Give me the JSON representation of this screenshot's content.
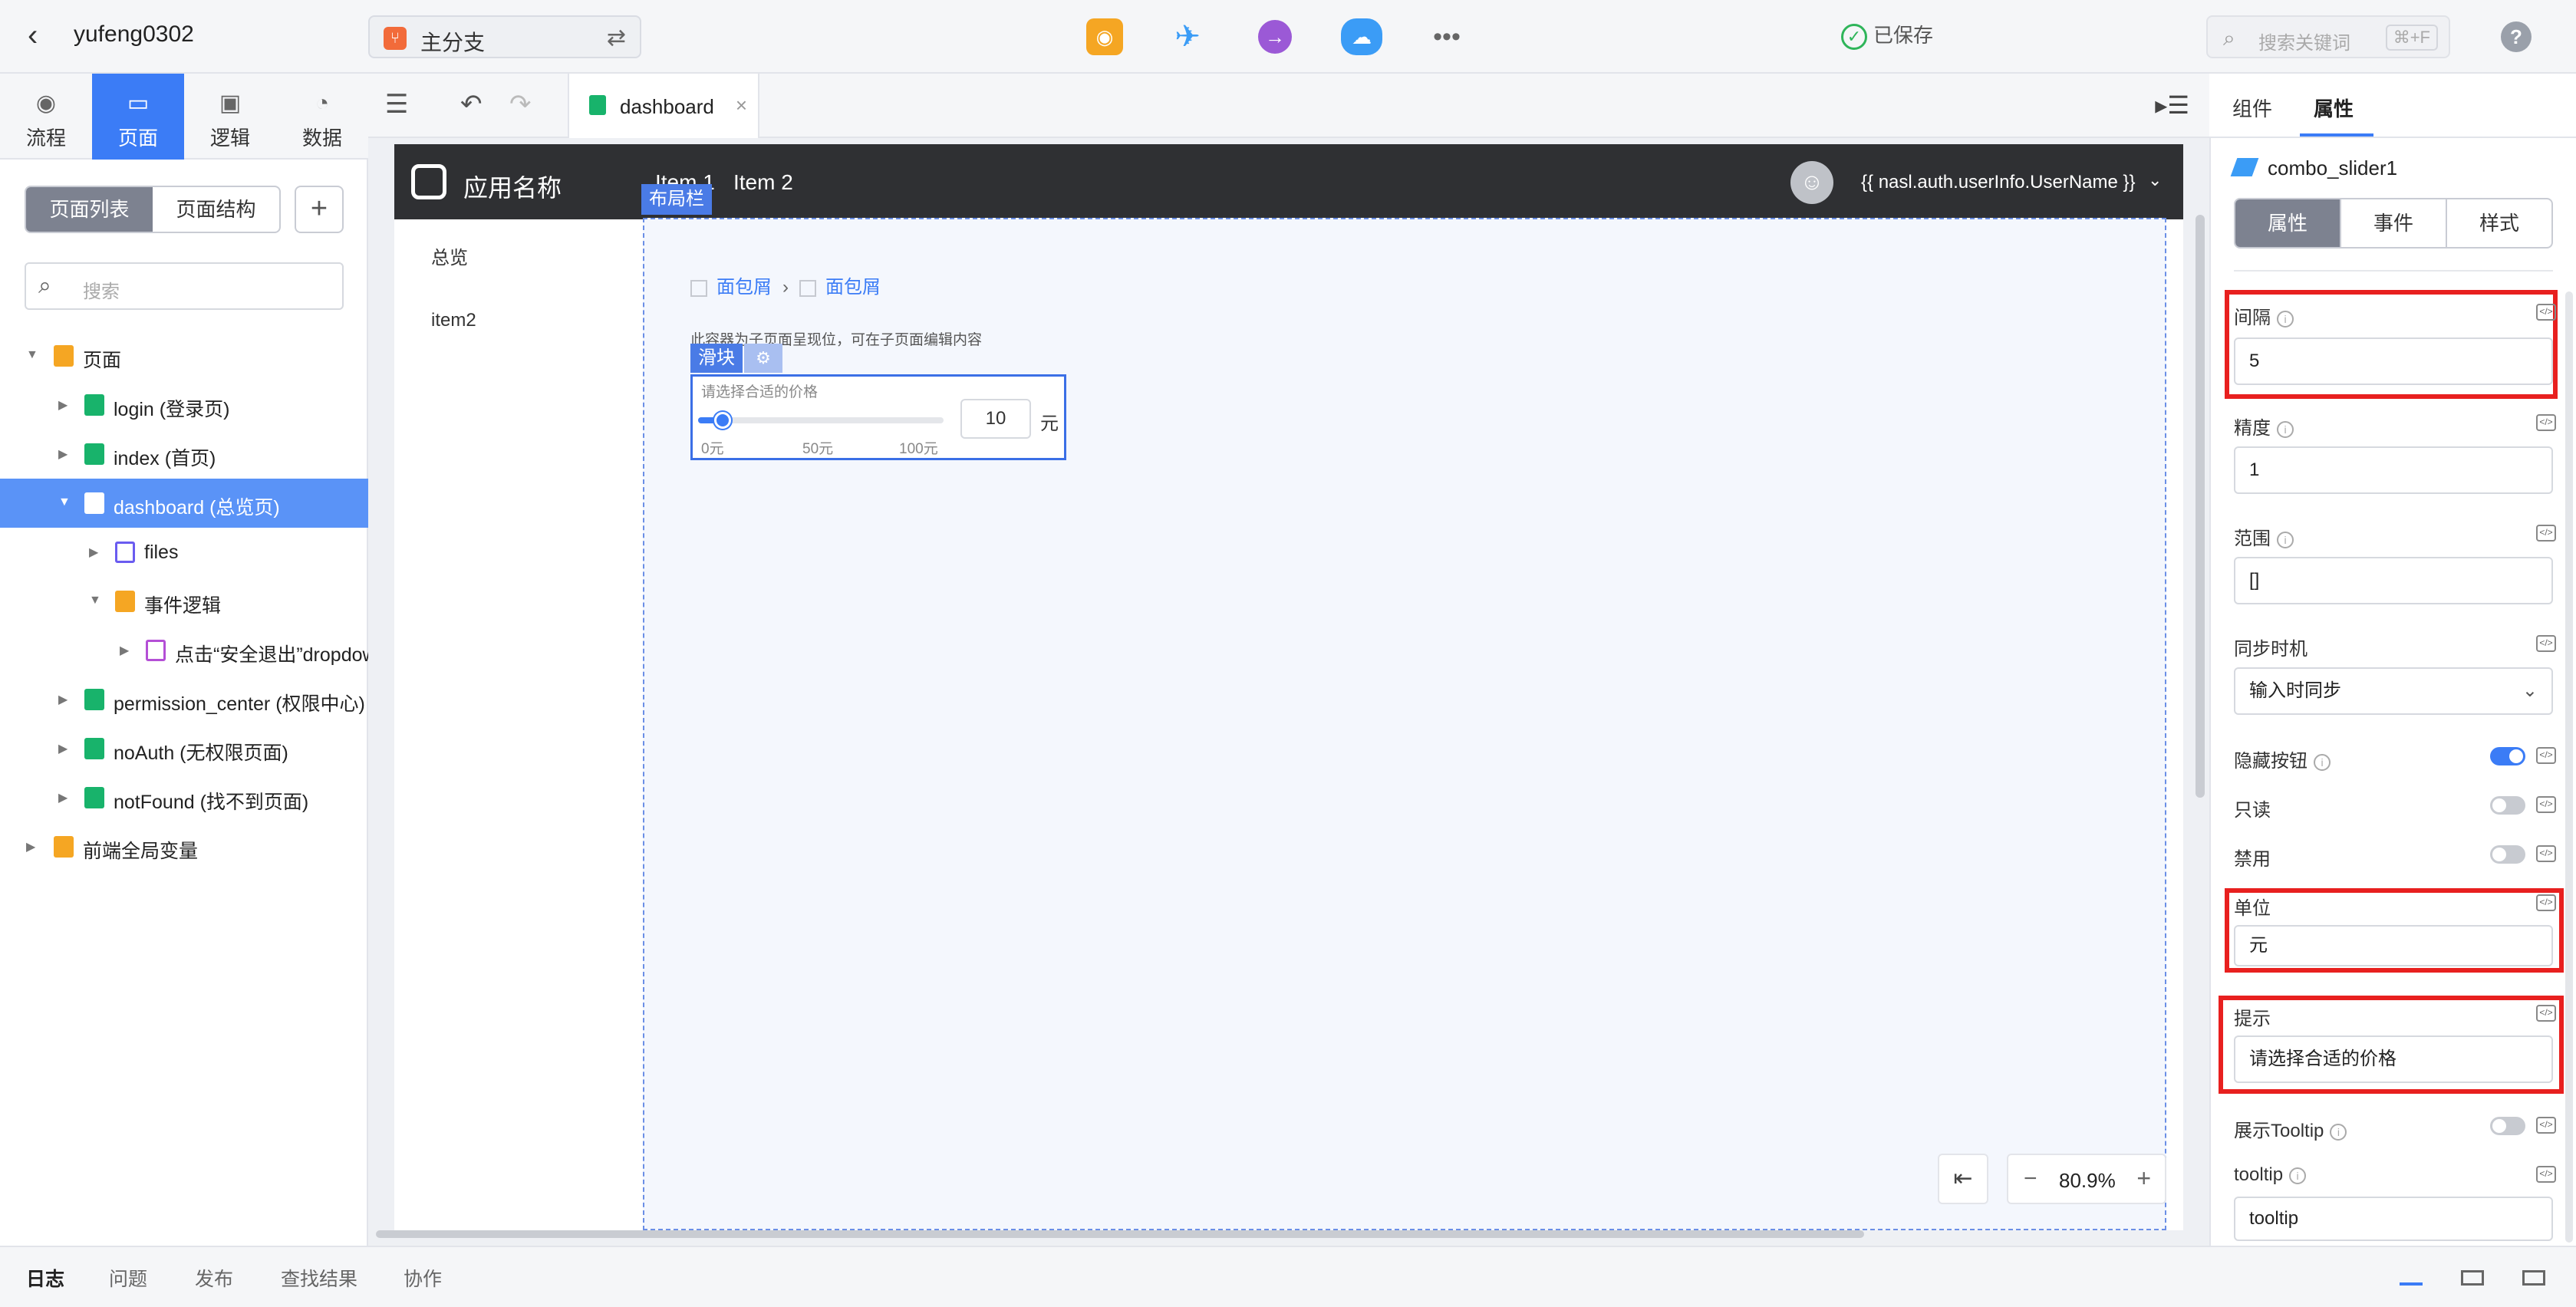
{
  "topbar": {
    "back_icon": "chevron-left-icon",
    "project_name": "yufeng0302",
    "branch_label": "主分支",
    "saved_label": "已保存",
    "search_placeholder": "搜索关键词",
    "search_shortcut": "⌘+F",
    "help": "?"
  },
  "leftnav": {
    "tabs": [
      {
        "label": "流程",
        "icon": "flow-icon"
      },
      {
        "label": "页面",
        "icon": "page-icon"
      },
      {
        "label": "逻辑",
        "icon": "chip-icon"
      },
      {
        "label": "数据",
        "icon": "pie-icon"
      }
    ]
  },
  "sidebar": {
    "seg_list": "页面列表",
    "seg_structure": "页面结构",
    "add": "+",
    "search_placeholder": "搜索",
    "tree": [
      {
        "label": "页面"
      },
      {
        "label": "login (登录页)"
      },
      {
        "label": "index (首页)"
      },
      {
        "label": "dashboard (总览页)"
      },
      {
        "label": "files"
      },
      {
        "label": "事件逻辑"
      },
      {
        "label": "点击“安全退出”dropdown"
      },
      {
        "label": "permission_center (权限中心)"
      },
      {
        "label": "noAuth (无权限页面)"
      },
      {
        "label": "notFound (找不到页面)"
      },
      {
        "label": "前端全局变量"
      }
    ]
  },
  "canvas": {
    "tab_name": "dashboard",
    "tab_close": "×",
    "app_name": "应用名称",
    "nav_item1": "Item 1",
    "nav_item2": "Item 2",
    "user_name": "{{ nasl.auth.userInfo.UserName }}",
    "layout_tag": "布局栏",
    "side_nav1": "总览",
    "side_nav2": "item2",
    "crumb1": "面包屑",
    "crumb2": "面包屑",
    "placeholder_note": "此容器为子页面呈现位，可在子页面编辑内容",
    "slider_tag": "滑块",
    "slider_hint": "请选择合适的价格",
    "slider_value": "10",
    "slider_unit": "元",
    "slider_fraction": 0.1,
    "tick_labels": [
      "0元",
      "50元",
      "100元"
    ],
    "zoom": "80.9%"
  },
  "rpanel": {
    "tab_components": "组件",
    "tab_properties": "属性",
    "component_name": "combo_slider1",
    "seg": [
      "属性",
      "事件",
      "样式"
    ],
    "props": {
      "step_label": "间隔",
      "step_value": "5",
      "precision_label": "精度",
      "precision_value": "1",
      "range_label": "范围",
      "range_value": "[]",
      "sync_label": "同步时机",
      "sync_value": "输入时同步",
      "hide_buttons_label": "隐藏按钮",
      "readonly_label": "只读",
      "disabled_label": "禁用",
      "unit_label": "单位",
      "unit_value": "元",
      "hint_label": "提示",
      "hint_value": "请选择合适的价格",
      "show_tooltip_label": "展示Tooltip",
      "tooltip_label": "tooltip",
      "tooltip_value": "tooltip"
    }
  },
  "bottombar": {
    "tabs": [
      "日志",
      "问题",
      "发布",
      "查找结果",
      "协作"
    ]
  },
  "colors": {
    "accent": "#3b7cf6",
    "highlight": "#e8201f",
    "appbar": "#2f3033"
  }
}
